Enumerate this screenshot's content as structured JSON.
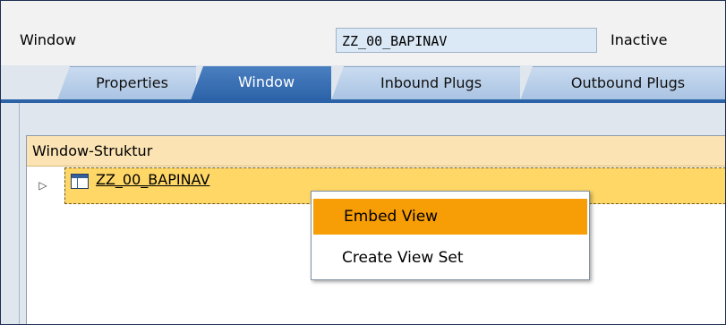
{
  "header": {
    "label": "Window",
    "name_value": "ZZ_00_BAPINAV",
    "status": "Inactive"
  },
  "tabs": [
    {
      "label": "Properties",
      "active": false
    },
    {
      "label": "Window",
      "active": true
    },
    {
      "label": "Inbound Plugs",
      "active": false
    },
    {
      "label": "Outbound Plugs",
      "active": false
    }
  ],
  "structure": {
    "header": "Window-Struktur",
    "root_node": {
      "label": "ZZ_00_BAPINAV",
      "icon": "window-icon",
      "expander": "▷"
    }
  },
  "context_menu": {
    "items": [
      {
        "label": "Embed View",
        "highlighted": true
      },
      {
        "label": "Create View Set",
        "highlighted": false
      }
    ]
  },
  "colors": {
    "tab_active": "#2c63a8",
    "tab_inactive": "#b6cde8",
    "struct_header": "#fbe3b4",
    "selected_row": "#fed767",
    "menu_highlight": "#f79d06"
  }
}
